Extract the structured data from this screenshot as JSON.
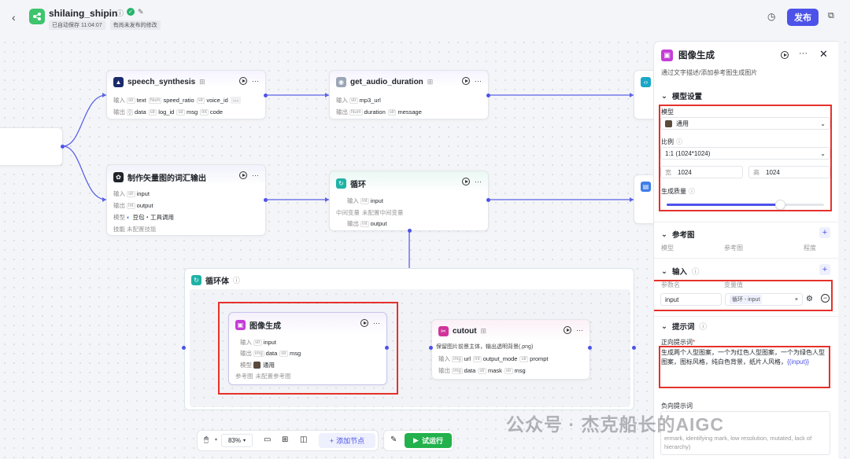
{
  "header": {
    "app_name": "shilaing_shipin",
    "autosave": "已自动保存 11:04:07",
    "unpublished": "有尚未发布的修改",
    "publish_label": "发布"
  },
  "nodes": {
    "speech": {
      "name": "speech_synthesis",
      "in_label": "输入",
      "out_label": "输出",
      "inputs": [
        {
          "t": "str",
          "v": "text"
        },
        {
          "t": "Num",
          "v": "speed_ratio"
        },
        {
          "t": "str",
          "v": "voice_id"
        }
      ],
      "more": "···",
      "outputs": [
        {
          "t": "{}",
          "v": "data"
        },
        {
          "t": "str",
          "v": "log_id"
        },
        {
          "t": "str",
          "v": "msg"
        },
        {
          "t": "Int",
          "v": "code"
        }
      ]
    },
    "audio": {
      "name": "get_audio_duration",
      "in_label": "输入",
      "out_label": "输出",
      "inputs": [
        {
          "t": "str",
          "v": "mp3_url"
        }
      ],
      "outputs": [
        {
          "t": "Num",
          "v": "duration"
        },
        {
          "t": "str",
          "v": "message"
        }
      ]
    },
    "vector": {
      "name": "制作矢量图的词汇输出",
      "in_label": "输入",
      "out_label": "输出",
      "model_label": "模型",
      "skill_label": "技能",
      "input": {
        "t": "str",
        "v": "input"
      },
      "output": {
        "t": "Int",
        "v": "output"
      },
      "model": "豆包・工具调用",
      "skill": "未配置技能"
    },
    "loop": {
      "name": "循环",
      "in_label": "输入",
      "mid_label": "中间变量",
      "out_label": "输出",
      "input": {
        "t": "Int",
        "v": "input"
      },
      "mid": "未配置中间变量",
      "output": {
        "t": "Int",
        "v": "output"
      }
    },
    "loopbody": {
      "name": "循环体"
    },
    "imagegen": {
      "name": "图像生成",
      "in_label": "输入",
      "out_label": "输出",
      "model_label": "模型",
      "ref_label": "参考图",
      "input": {
        "t": "str",
        "v": "input"
      },
      "outputs": [
        {
          "t": "img",
          "v": "data"
        },
        {
          "t": "str",
          "v": "msg"
        }
      ],
      "model": "通用",
      "ref": "未配置参考图"
    },
    "cutout": {
      "name": "cutout",
      "desc": "保留图片前景主体，输出透明背景(.png)",
      "in_label": "输入",
      "out_label": "输出",
      "inputs": [
        {
          "t": "img",
          "v": "url"
        },
        {
          "t": "Int",
          "v": "output_mode"
        },
        {
          "t": "str",
          "v": "prompt"
        }
      ],
      "outputs": [
        {
          "t": "img",
          "v": "data"
        },
        {
          "t": "str",
          "v": "mask"
        },
        {
          "t": "str",
          "v": "msg"
        }
      ]
    }
  },
  "toolbar": {
    "zoom": "83%",
    "add_node": "添加节点",
    "run": "试运行"
  },
  "panel": {
    "title": "图像生成",
    "desc": "通过文字描述/添加参考图生成图片",
    "model_settings": "模型设置",
    "model_label": "模型",
    "model_value": "通用",
    "ratio_label": "比例",
    "ratio_value": "1:1 (1024*1024)",
    "width_label": "宽",
    "width_value": "1024",
    "height_label": "高",
    "height_value": "1024",
    "quality_label": "生成质量",
    "quality_level": 0.72,
    "ref_title": "参考图",
    "ref_cols": [
      "模型",
      "参考图",
      "程度"
    ],
    "input_title": "输入",
    "param_name": "参数名",
    "var_value": "变量值",
    "param_value": "input",
    "var_ref": "循环 - input",
    "prompt_title": "提示词",
    "pos_label": "正向提示词",
    "pos_text": "生成两个人型图案，一个为红色人型图案，一个为绿色人型图案，图标风格，纯白色背景，纸片人风格，",
    "pos_var": "{{input}}",
    "neg_label": "负向提示词",
    "neg_text": "ermark, identifying mark, low resolution, mutated, lack of hierarchy)"
  },
  "watermark": "公众号 · 杰克船长的AIGC",
  "colors": {
    "accent": "#4d53e8",
    "red_highlight": "#e5312b",
    "run_green": "#22b14c"
  }
}
